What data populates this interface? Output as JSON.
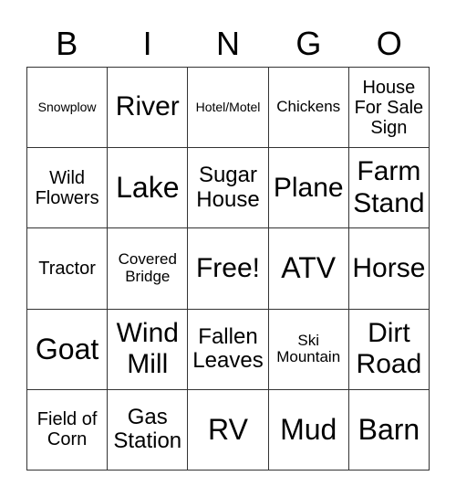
{
  "header": [
    "B",
    "I",
    "N",
    "G",
    "O"
  ],
  "cells": [
    [
      "Snowplow",
      "River",
      "Hotel/Motel",
      "Chickens",
      "House\nFor Sale\nSign"
    ],
    [
      "Wild\nFlowers",
      "Lake",
      "Sugar\nHouse",
      "Plane",
      "Farm\nStand"
    ],
    [
      "Tractor",
      "Covered\nBridge",
      "Free!",
      "ATV",
      "Horse"
    ],
    [
      "Goat",
      "Wind\nMill",
      "Fallen\nLeaves",
      "Ski\nMountain",
      "Dirt\nRoad"
    ],
    [
      "Field of\nCorn",
      "Gas\nStation",
      "RV",
      "Mud",
      "Barn"
    ]
  ]
}
